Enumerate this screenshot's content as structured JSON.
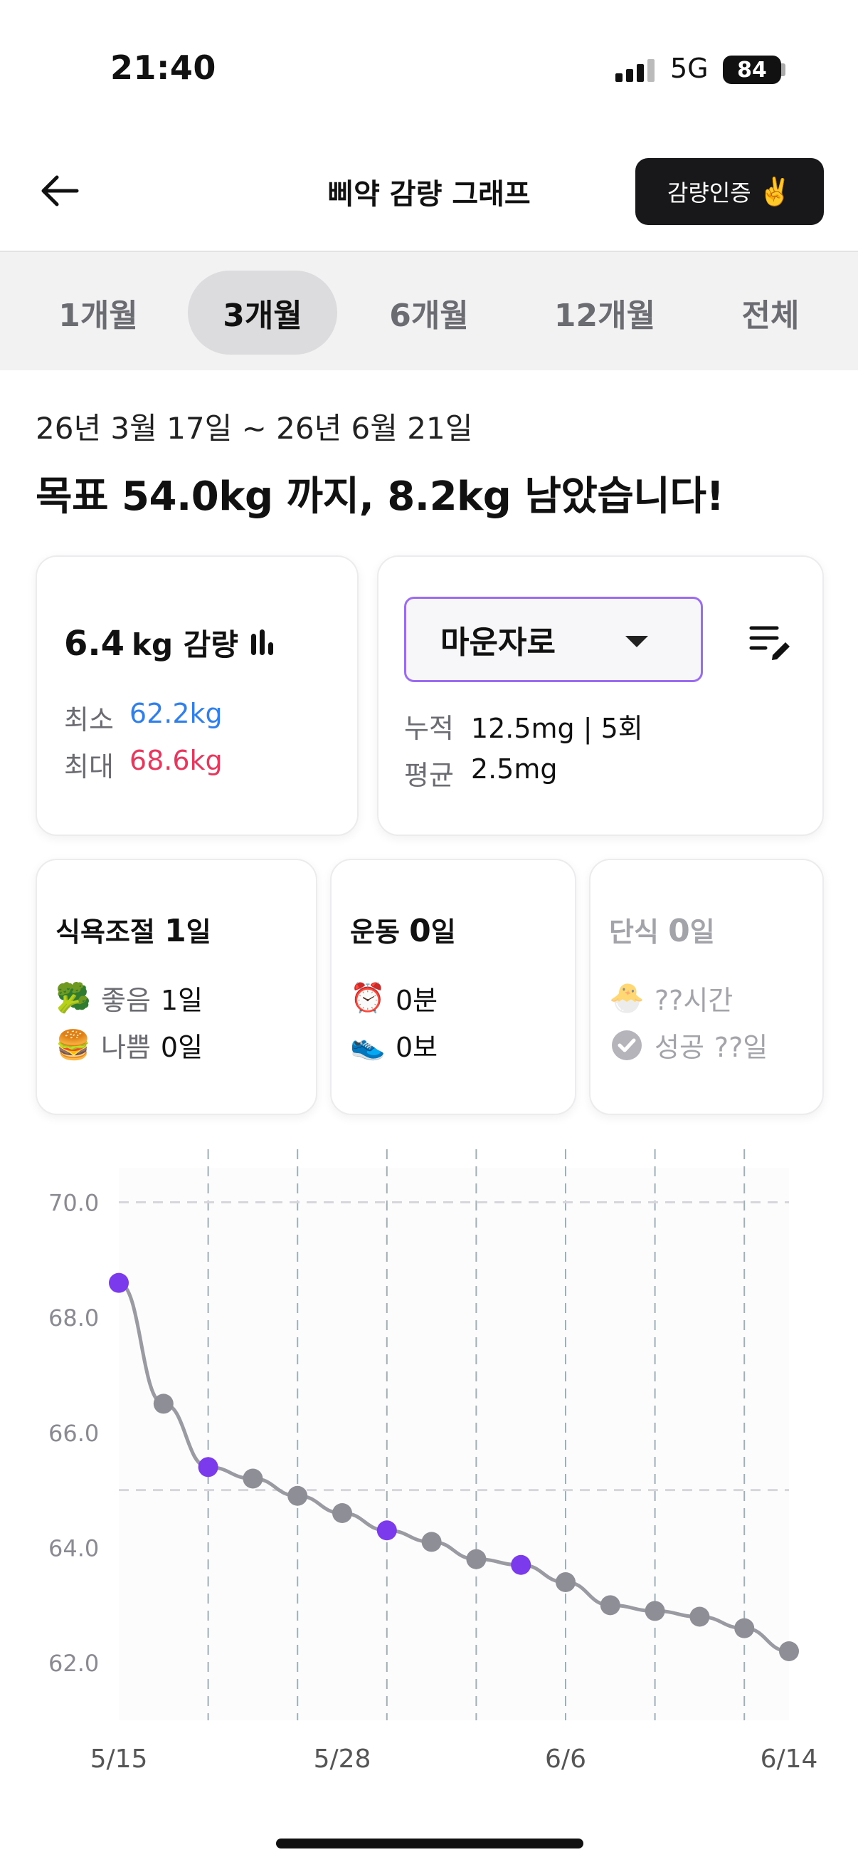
{
  "status": {
    "time": "21:40",
    "network": "5G",
    "battery": "84"
  },
  "header": {
    "title": "삐약 감량 그래프",
    "cert_label": "감량인증",
    "cert_emoji": "✌️"
  },
  "tabs": [
    {
      "label": "1개월",
      "active": false
    },
    {
      "label": "3개월",
      "active": true
    },
    {
      "label": "6개월",
      "active": false
    },
    {
      "label": "12개월",
      "active": false
    },
    {
      "label": "전체",
      "active": false
    }
  ],
  "summary": {
    "date_range": "26년 3월 17일 ~ 26년 6월 21일",
    "goal_message": "목표 54.0kg 까지, 8.2kg 남았습니다!"
  },
  "loss_card": {
    "amount": "6.4",
    "unit": "kg 감량",
    "min_label": "최소",
    "min_value": "62.2kg",
    "max_label": "최대",
    "max_value": "68.6kg"
  },
  "drug_card": {
    "selected": "마운자로",
    "cumulative_label": "누적",
    "cumulative_value": "12.5mg | 5회",
    "average_label": "평균",
    "average_value": "2.5mg"
  },
  "diet_card": {
    "title": "식욕조절",
    "days": "1",
    "days_unit": "일",
    "good_emoji": "🥦",
    "good_label": "좋음",
    "good_value": "1일",
    "bad_emoji": "🍔",
    "bad_label": "나쁨",
    "bad_value": "0일"
  },
  "exercise_card": {
    "title": "운동",
    "days": "0",
    "days_unit": "일",
    "time_emoji": "⏰",
    "time_value": "0분",
    "steps_emoji": "👟",
    "steps_value": "0보"
  },
  "fasting_card": {
    "title": "단식",
    "days": "0",
    "days_unit": "일",
    "hours_emoji": "🐣",
    "hours_value": "??시간",
    "success_label": "성공",
    "success_value": "??일"
  },
  "colors": {
    "accent": "#7c3aed",
    "point": "#8e8e96",
    "line": "#9a9aa2",
    "min": "#2f80ed",
    "max": "#e8365d"
  },
  "chart_data": {
    "type": "line",
    "ylim": [
      61.0,
      70.6
    ],
    "y_ticks": [
      "70.0",
      "68.0",
      "66.0",
      "64.0",
      "62.0"
    ],
    "y_tick_values": [
      70.0,
      68.0,
      66.0,
      64.0,
      62.0
    ],
    "x_tick_labels": [
      "5/15",
      "5/28",
      "6/6",
      "6/14"
    ],
    "x_tick_index": [
      0,
      5,
      10,
      15
    ],
    "reference_lines": [
      70.0,
      65.0
    ],
    "series": [
      {
        "values": [
          68.6,
          66.5,
          65.4,
          65.2,
          64.9,
          64.6,
          64.3,
          64.1,
          63.8,
          63.7,
          63.4,
          63.0,
          62.9,
          62.8,
          62.6,
          62.2
        ],
        "injection_points": [
          0,
          2,
          6,
          9
        ]
      }
    ]
  }
}
